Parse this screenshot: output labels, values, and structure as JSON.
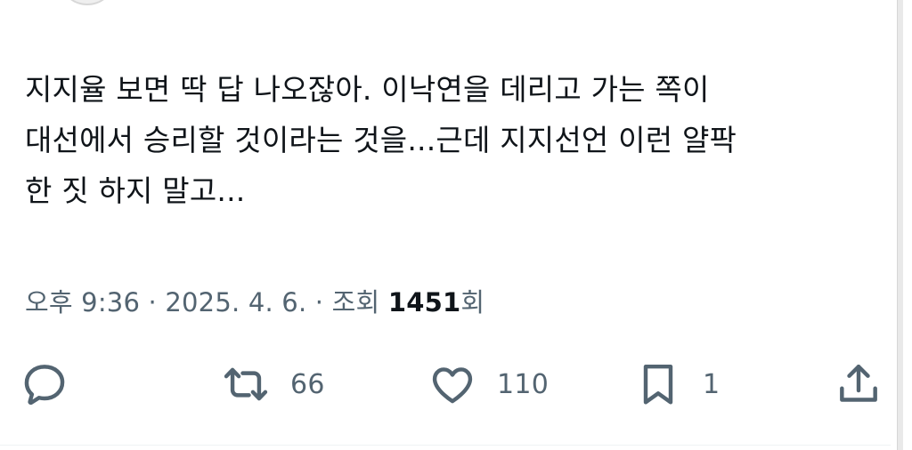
{
  "tweet": {
    "lines": [
      "지지율 보면 딱 답 나오잖아. 이낙연을 데리고 가는 쪽이",
      "대선에서 승리할 것이라는 것을...근데 지지선언 이런 얄팍",
      "한 짓 하지 말고..."
    ]
  },
  "meta": {
    "time": "오후 9:36",
    "date": "2025. 4. 6.",
    "separator": "·",
    "views_label": "조회",
    "views_count": "1451",
    "views_suffix": "회"
  },
  "actions": {
    "reply": {
      "icon": "reply-icon"
    },
    "retweet": {
      "icon": "retweet-icon",
      "count": "66"
    },
    "like": {
      "icon": "heart-icon",
      "count": "110"
    },
    "bookmark": {
      "icon": "bookmark-icon",
      "count": "1"
    },
    "share": {
      "icon": "share-icon"
    }
  },
  "colors": {
    "text": "#0f1419",
    "secondary": "#536471"
  }
}
